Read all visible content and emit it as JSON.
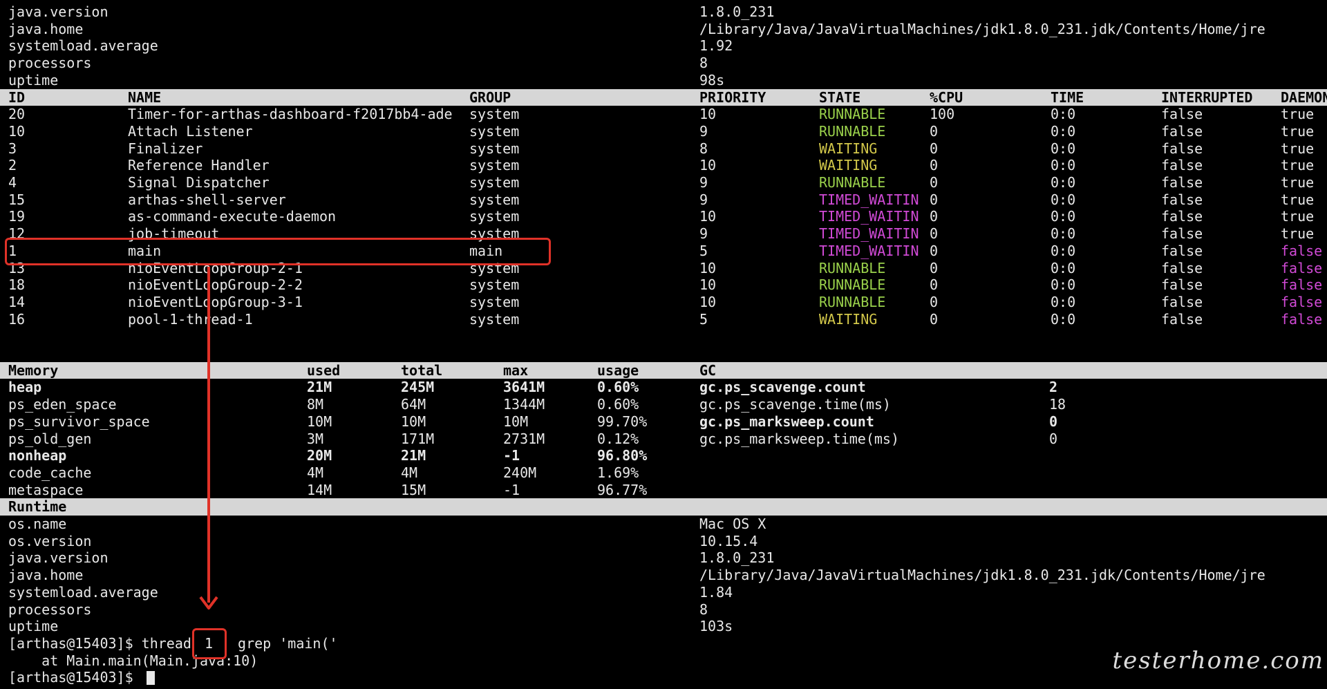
{
  "top_info": [
    {
      "key": "java.version",
      "value": "1.8.0_231"
    },
    {
      "key": "java.home",
      "value": "/Library/Java/JavaVirtualMachines/jdk1.8.0_231.jdk/Contents/Home/jre"
    },
    {
      "key": "systemload.average",
      "value": "1.92"
    },
    {
      "key": "processors",
      "value": "8"
    },
    {
      "key": "uptime",
      "value": "98s"
    }
  ],
  "threads": {
    "headers": [
      "ID",
      "NAME",
      "GROUP",
      "PRIORITY",
      "STATE",
      "%CPU",
      "TIME",
      "INTERRUPTED",
      "DAEMON"
    ],
    "rows": [
      {
        "id": "20",
        "name": "Timer-for-arthas-dashboard-f2017bb4-ade",
        "group": "system",
        "priority": "10",
        "state": "RUNNABLE",
        "cpu": "100",
        "time": "0:0",
        "interrupted": "false",
        "daemon": "true"
      },
      {
        "id": "10",
        "name": "Attach Listener",
        "group": "system",
        "priority": "9",
        "state": "RUNNABLE",
        "cpu": "0",
        "time": "0:0",
        "interrupted": "false",
        "daemon": "true"
      },
      {
        "id": "3",
        "name": "Finalizer",
        "group": "system",
        "priority": "8",
        "state": "WAITING",
        "cpu": "0",
        "time": "0:0",
        "interrupted": "false",
        "daemon": "true"
      },
      {
        "id": "2",
        "name": "Reference Handler",
        "group": "system",
        "priority": "10",
        "state": "WAITING",
        "cpu": "0",
        "time": "0:0",
        "interrupted": "false",
        "daemon": "true"
      },
      {
        "id": "4",
        "name": "Signal Dispatcher",
        "group": "system",
        "priority": "9",
        "state": "RUNNABLE",
        "cpu": "0",
        "time": "0:0",
        "interrupted": "false",
        "daemon": "true"
      },
      {
        "id": "15",
        "name": "arthas-shell-server",
        "group": "system",
        "priority": "9",
        "state": "TIMED_WAITIN",
        "cpu": "0",
        "time": "0:0",
        "interrupted": "false",
        "daemon": "true"
      },
      {
        "id": "19",
        "name": "as-command-execute-daemon",
        "group": "system",
        "priority": "10",
        "state": "TIMED_WAITIN",
        "cpu": "0",
        "time": "0:0",
        "interrupted": "false",
        "daemon": "true"
      },
      {
        "id": "12",
        "name": "job-timeout",
        "group": "system",
        "priority": "9",
        "state": "TIMED_WAITIN",
        "cpu": "0",
        "time": "0:0",
        "interrupted": "false",
        "daemon": "true"
      },
      {
        "id": "1",
        "name": "main",
        "group": "main",
        "priority": "5",
        "state": "TIMED_WAITIN",
        "cpu": "0",
        "time": "0:0",
        "interrupted": "false",
        "daemon": "false"
      },
      {
        "id": "13",
        "name": "nioEventLoopGroup-2-1",
        "group": "system",
        "priority": "10",
        "state": "RUNNABLE",
        "cpu": "0",
        "time": "0:0",
        "interrupted": "false",
        "daemon": "false"
      },
      {
        "id": "18",
        "name": "nioEventLoopGroup-2-2",
        "group": "system",
        "priority": "10",
        "state": "RUNNABLE",
        "cpu": "0",
        "time": "0:0",
        "interrupted": "false",
        "daemon": "false"
      },
      {
        "id": "14",
        "name": "nioEventLoopGroup-3-1",
        "group": "system",
        "priority": "10",
        "state": "RUNNABLE",
        "cpu": "0",
        "time": "0:0",
        "interrupted": "false",
        "daemon": "false"
      },
      {
        "id": "16",
        "name": "pool-1-thread-1",
        "group": "system",
        "priority": "5",
        "state": "WAITING",
        "cpu": "0",
        "time": "0:0",
        "interrupted": "false",
        "daemon": "false"
      }
    ]
  },
  "memory": {
    "headers": [
      "Memory",
      "used",
      "total",
      "max",
      "usage",
      "GC"
    ],
    "rows": [
      {
        "name": "heap",
        "used": "21M",
        "total": "245M",
        "max": "3641M",
        "usage": "0.60%",
        "bold": true
      },
      {
        "name": "ps_eden_space",
        "used": "8M",
        "total": "64M",
        "max": "1344M",
        "usage": "0.60%",
        "bold": false
      },
      {
        "name": "ps_survivor_space",
        "used": "10M",
        "total": "10M",
        "max": "10M",
        "usage": "99.70%",
        "bold": false
      },
      {
        "name": "ps_old_gen",
        "used": "3M",
        "total": "171M",
        "max": "2731M",
        "usage": "0.12%",
        "bold": false
      },
      {
        "name": "nonheap",
        "used": "20M",
        "total": "21M",
        "max": "-1",
        "usage": "96.80%",
        "bold": true
      },
      {
        "name": "code_cache",
        "used": "4M",
        "total": "4M",
        "max": "240M",
        "usage": "1.69%",
        "bold": false
      },
      {
        "name": "metaspace",
        "used": "14M",
        "total": "15M",
        "max": "-1",
        "usage": "96.77%",
        "bold": false
      }
    ],
    "gc": [
      {
        "key": "gc.ps_scavenge.count",
        "value": "2",
        "bold": true
      },
      {
        "key": "gc.ps_scavenge.time(ms)",
        "value": "18",
        "bold": false
      },
      {
        "key": "gc.ps_marksweep.count",
        "value": "0",
        "bold": true
      },
      {
        "key": "gc.ps_marksweep.time(ms)",
        "value": "0",
        "bold": false
      }
    ]
  },
  "runtime": {
    "header": "Runtime",
    "rows": [
      {
        "key": "os.name",
        "value": "Mac OS X"
      },
      {
        "key": "os.version",
        "value": "10.15.4"
      },
      {
        "key": "java.version",
        "value": "1.8.0_231"
      },
      {
        "key": "java.home",
        "value": "/Library/Java/JavaVirtualMachines/jdk1.8.0_231.jdk/Contents/Home/jre"
      },
      {
        "key": "systemload.average",
        "value": "1.84"
      },
      {
        "key": "processors",
        "value": "8"
      },
      {
        "key": "uptime",
        "value": "103s"
      }
    ]
  },
  "console": {
    "command_prefix": "[arthas@15403]$ thread ",
    "command_arg": "1",
    "command_suffix": " grep 'main('",
    "output": "    at Main.main(Main.java:10)",
    "prompt": "[arthas@15403]$ "
  },
  "watermark": "testerhome.com",
  "colors": {
    "runnable": "#9ad14b",
    "waiting": "#d3c84a",
    "timed_waiting": "#d14ad6",
    "annotation": "#e03228",
    "header_bg": "#d6d6d6"
  }
}
